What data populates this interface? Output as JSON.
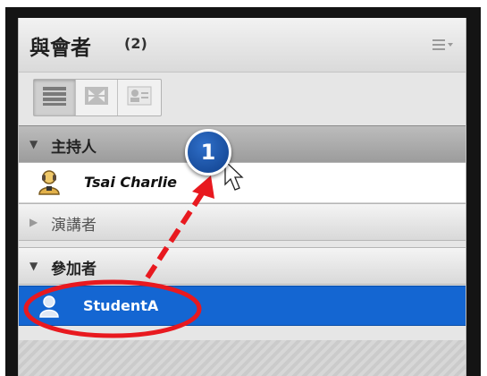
{
  "panel": {
    "title": "與會者",
    "count": "(2)",
    "menu_icon": "menu-lines-icon",
    "toolbar": [
      "list-view-icon",
      "grid-view-icon",
      "attendee-card-icon"
    ]
  },
  "sections": {
    "host": {
      "label": "主持人",
      "arrow": "▼"
    },
    "presenter": {
      "label": "演講者",
      "arrow": "▶"
    },
    "participant": {
      "label": "參加者",
      "arrow": "▼"
    }
  },
  "rows": {
    "host_user": {
      "name": "Tsai Charlie",
      "icon": "host-user-icon"
    },
    "participant_user": {
      "name": "StudentA",
      "icon": "participant-user-icon"
    }
  },
  "annotation": {
    "step": "1",
    "circle_color": "#e8191f",
    "arrow_color": "#e8191f",
    "badge_color": "#1a4fa0"
  }
}
